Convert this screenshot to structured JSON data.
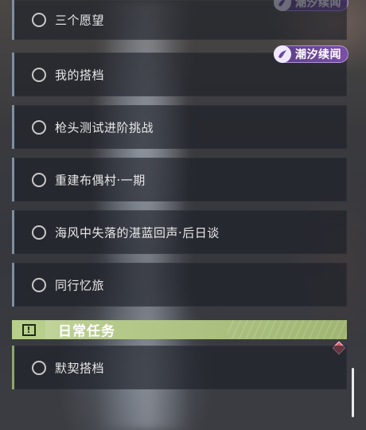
{
  "tag": {
    "label": "潮汐续闻"
  },
  "quests": [
    {
      "label": "三个愿望"
    },
    {
      "label": "我的搭档"
    },
    {
      "label": "枪头测试进阶挑战"
    },
    {
      "label": "重建布偶村·一期"
    },
    {
      "label": "海风中失落的湛蓝回声·后日谈"
    },
    {
      "label": "同行忆旅"
    }
  ],
  "daily": {
    "title": "日常任务",
    "items": [
      {
        "label": "默契搭档"
      }
    ]
  },
  "colors": {
    "tag_bg": "#6b48a0",
    "daily_accent": "#b7cf8a",
    "quest_bar": "#7d8fa0",
    "alert": "#e0566a"
  }
}
